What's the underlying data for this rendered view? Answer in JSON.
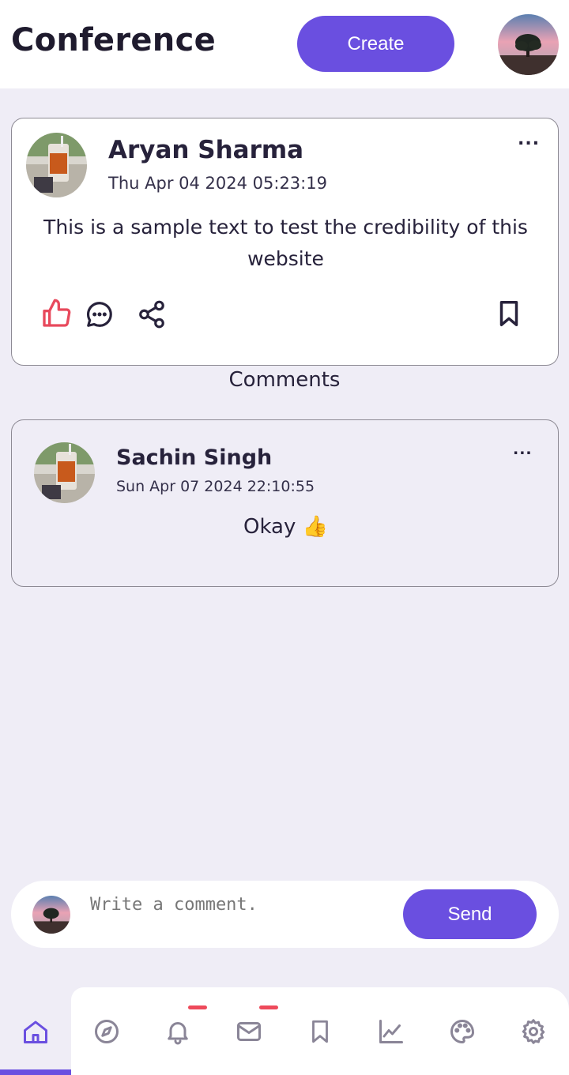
{
  "header": {
    "title": "Conference",
    "create_label": "Create",
    "avatar_icon": "landscape-tree-avatar"
  },
  "post": {
    "author": "Aryan Sharma",
    "timestamp": "Thu Apr 04 2024 05:23:19",
    "text": "This is a sample text to test the credibility of this website",
    "more_label": "...",
    "like_color": "#e8495c"
  },
  "comments_heading": "Comments",
  "comments": [
    {
      "author": "Sachin Singh",
      "timestamp": "Sun Apr 07 2024 22:10:55",
      "text": "Okay 👍",
      "more_label": "..."
    }
  ],
  "composer": {
    "placeholder": "Write a comment.",
    "send_label": "Send"
  },
  "nav": {
    "items": [
      "home-icon",
      "compass-icon",
      "bell-icon",
      "mail-icon",
      "bookmark-icon",
      "chart-icon",
      "palette-icon",
      "gear-icon"
    ],
    "active": "home",
    "accent": "#6a4fe0",
    "badge_color": "#ee4a5b"
  }
}
